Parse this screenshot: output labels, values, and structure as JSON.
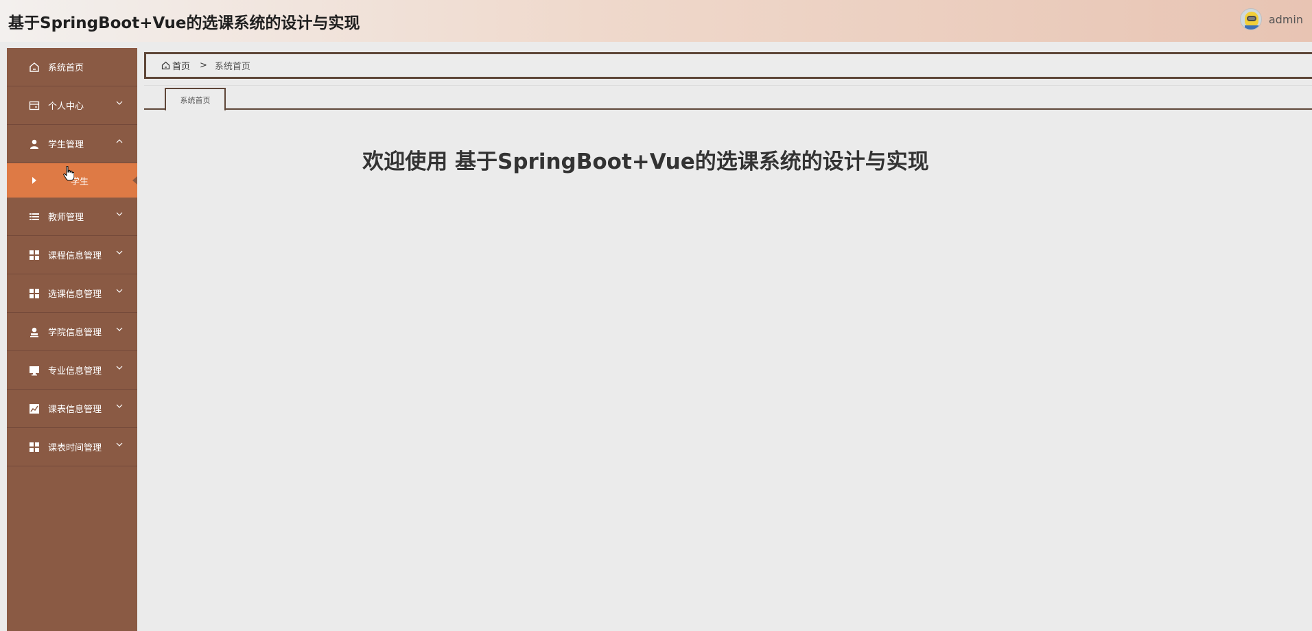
{
  "header": {
    "title": "基于SpringBoot+Vue的选课系统的设计与实现",
    "username": "admin"
  },
  "sidebar": {
    "items": [
      {
        "label": "系统首页",
        "icon": "home-icon",
        "has_arrow": false
      },
      {
        "label": "个人中心",
        "icon": "wallet-icon",
        "has_arrow": true
      },
      {
        "label": "学生管理",
        "icon": "user-icon",
        "has_arrow": true,
        "expanded": true
      },
      {
        "label": "教师管理",
        "icon": "list-icon",
        "has_arrow": true
      },
      {
        "label": "课程信息管理",
        "icon": "grid-icon",
        "has_arrow": true
      },
      {
        "label": "选课信息管理",
        "icon": "grid-icon",
        "has_arrow": true
      },
      {
        "label": "学院信息管理",
        "icon": "stamp-icon",
        "has_arrow": true
      },
      {
        "label": "专业信息管理",
        "icon": "monitor-icon",
        "has_arrow": true
      },
      {
        "label": "课表信息管理",
        "icon": "chart-icon",
        "has_arrow": true
      },
      {
        "label": "课表时间管理",
        "icon": "grid-icon",
        "has_arrow": true
      }
    ],
    "submenu": {
      "label": "学生",
      "active_color": "#de7a45"
    }
  },
  "breadcrumb": {
    "home": "首页",
    "separator": ">",
    "current": "系统首页"
  },
  "tabs": [
    {
      "label": "系统首页"
    }
  ],
  "main": {
    "welcome": "欢迎使用 基于SpringBoot+Vue的选课系统的设计与实现"
  },
  "colors": {
    "sidebar_bg": "#8a5a44",
    "active_bg": "#de7a45",
    "border": "#5e4638",
    "content_bg": "#ebebeb"
  }
}
